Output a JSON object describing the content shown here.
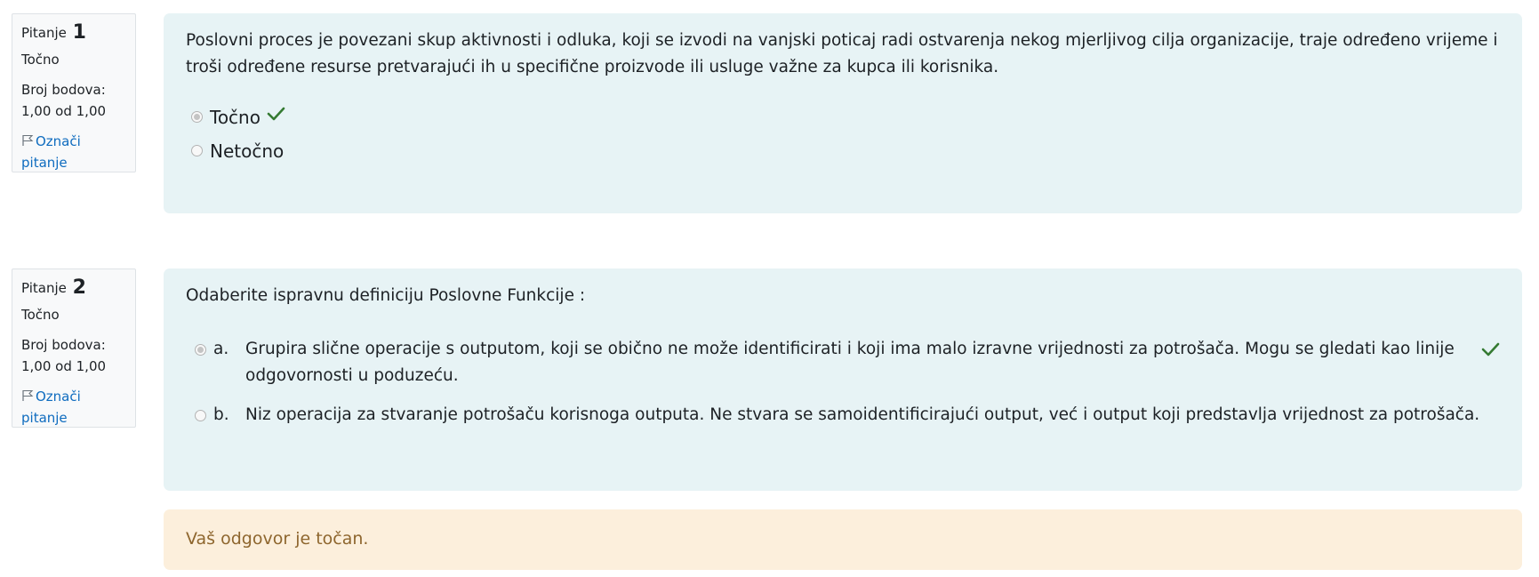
{
  "questions": [
    {
      "label": "Pitanje",
      "number": "1",
      "state": "Točno",
      "grade_label": "Broj bodova:",
      "grade_value": "1,00 od 1,00",
      "flag_line1": "Označi",
      "flag_line2": "pitanje",
      "text": "Poslovni proces je povezani skup aktivnosti i odluka, koji se izvodi na vanjski poticaj radi ostvarenja nekog mjerljivog cilja organizacije, traje određeno vrijeme i troši određene resurse pretvarajući ih u specifične proizvode ili usluge važne za kupca ili korisnika.",
      "options": [
        {
          "text": "Točno",
          "selected": true,
          "correct": true
        },
        {
          "text": "Netočno",
          "selected": false,
          "correct": false
        }
      ]
    },
    {
      "label": "Pitanje",
      "number": "2",
      "state": "Točno",
      "grade_label": "Broj bodova:",
      "grade_value": "1,00 od 1,00",
      "flag_line1": "Označi",
      "flag_line2": "pitanje",
      "text": "Odaberite ispravnu definiciju Poslovne Funkcije :",
      "options": [
        {
          "letter": "a.",
          "text": "Grupira slične operacije s outputom, koji se obično ne može identificirati i koji ima malo izravne vrijednosti za potrošača. Mogu se gledati kao linije odgovornosti u poduzeću.",
          "selected": true,
          "correct": true
        },
        {
          "letter": "b.",
          "text": "Niz operacija za stvaranje potrošaču korisnoga outputa. Ne stvara se samoidentificirajući output, već i output koji predstavlja vrijednost za potrošača.",
          "selected": false,
          "correct": false
        }
      ],
      "feedback": "Vaš odgovor je točan."
    }
  ],
  "colors": {
    "content_bg": "#e7f3f5",
    "feedback_bg": "#fcefdc",
    "feedback_text": "#8e662e",
    "link": "#0f6cbf",
    "check": "#357a32"
  },
  "icons": {
    "flag": "flag-icon",
    "check": "check-icon"
  }
}
